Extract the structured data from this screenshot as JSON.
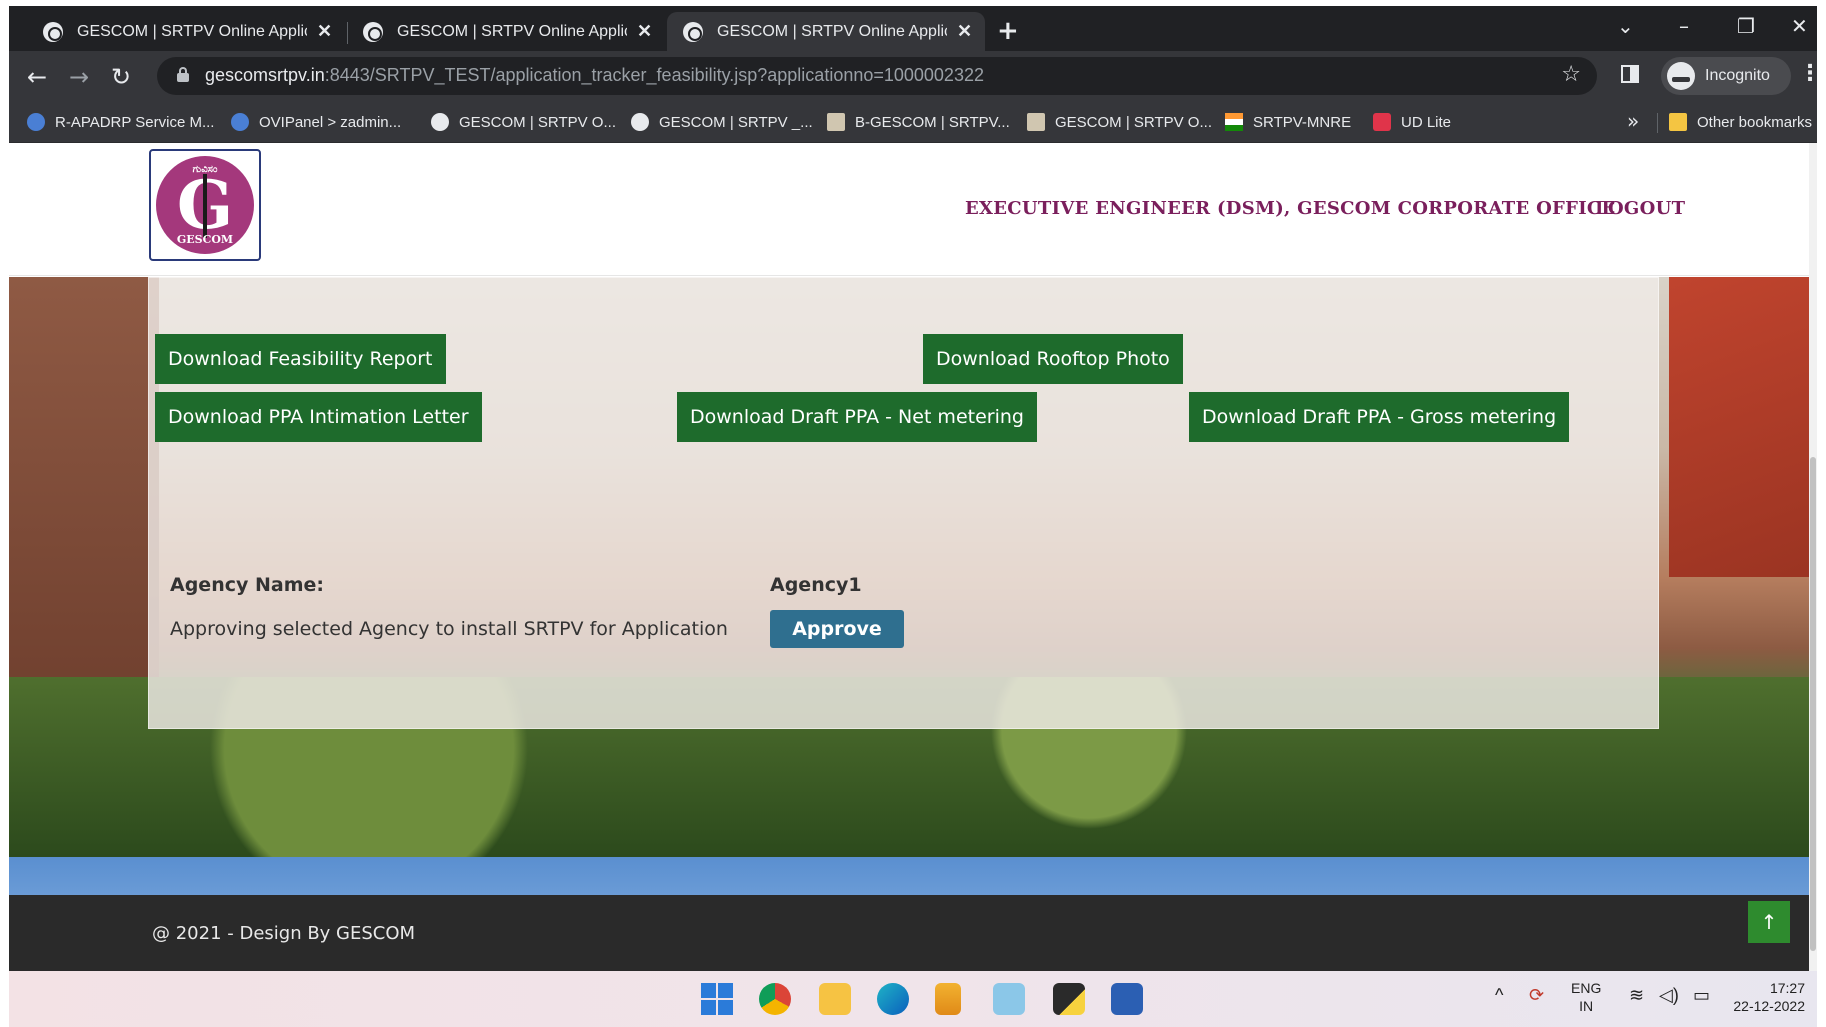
{
  "browser": {
    "tabs": [
      {
        "title": "GESCOM | SRTPV Online Applicat",
        "active": false
      },
      {
        "title": "GESCOM | SRTPV Online Applicat",
        "active": false
      },
      {
        "title": "GESCOM | SRTPV Online Applicat",
        "active": true
      }
    ],
    "url_host": "gescomsrtpv.in",
    "url_path": ":8443/SRTPV_TEST/application_tracker_feasibility.jsp?applicationno=1000002322",
    "profile_label": "Incognito",
    "bookmarks": [
      {
        "label": "R-APADRP Service M...",
        "icon": "globe-blue-icon"
      },
      {
        "label": "OVIPanel > zadmin...",
        "icon": "ovipanel-icon"
      },
      {
        "label": "GESCOM | SRTPV O...",
        "icon": "globe-icon"
      },
      {
        "label": "GESCOM | SRTPV _...",
        "icon": "globe-icon"
      },
      {
        "label": "B-GESCOM | SRTPV...",
        "icon": "image-icon"
      },
      {
        "label": "GESCOM | SRTPV O...",
        "icon": "image-icon"
      },
      {
        "label": "SRTPV-MNRE",
        "icon": "india-flag-icon"
      },
      {
        "label": "UD Lite",
        "icon": "udlite-icon"
      }
    ],
    "other_bookmarks": "Other bookmarks"
  },
  "header": {
    "logo_top_text": "ಗುವಿಸಂ",
    "logo_letter": "G",
    "logo_bottom_text": "GESCOM",
    "office": "EXECUTIVE ENGINEER (DSM), GESCOM CORPORATE OFFICE",
    "logout": "LOGOUT"
  },
  "panel": {
    "buttons": {
      "feasibility": "Download Feasibility Report",
      "rooftop": "Download Rooftop Photo",
      "ppa_intimation": "Download PPA Intimation Letter",
      "draft_net": "Download Draft PPA - Net metering",
      "draft_gross": "Download Draft PPA - Gross metering"
    },
    "agency_label": "Agency Name:",
    "agency_value": "Agency1",
    "approve_text": "Approving selected Agency to install SRTPV for Application",
    "approve_button": "Approve"
  },
  "footer": {
    "text": "@ 2021 - Design By  GESCOM",
    "to_top": "↑"
  },
  "taskbar": {
    "lang_top": "ENG",
    "lang_bottom": "IN",
    "time": "17:27",
    "date": "22-12-2022"
  },
  "colors": {
    "brand_green": "#1e6b2c",
    "approve_blue": "#2f6f8f",
    "header_link": "#7a1f5c",
    "logo_magenta": "#a4387c"
  }
}
